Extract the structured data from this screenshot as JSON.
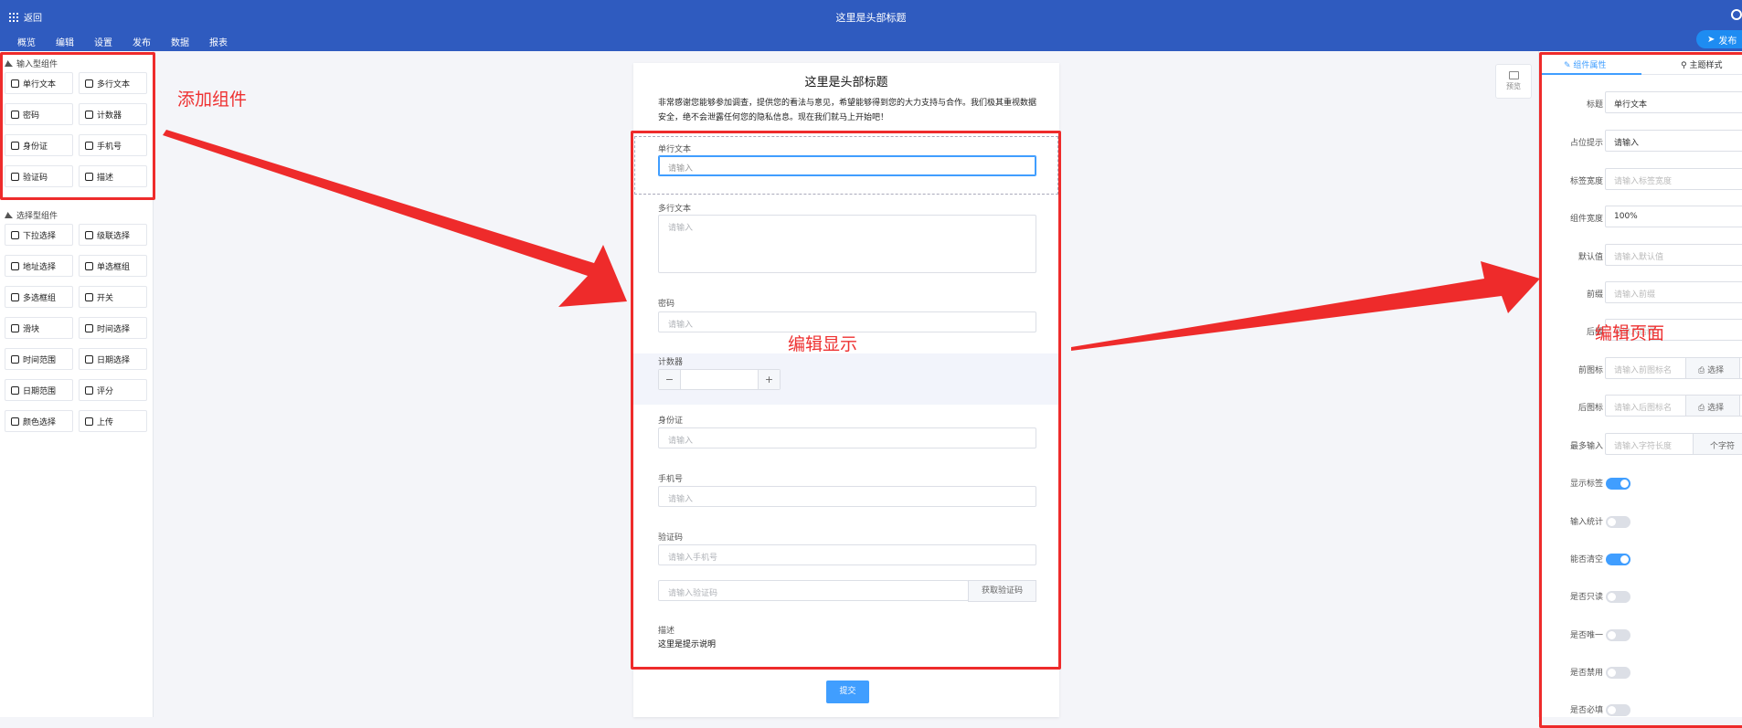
{
  "header": {
    "back_label": "返回",
    "title": "这里是头部标题",
    "nav": [
      "概览",
      "编辑",
      "设置",
      "发布",
      "数据",
      "报表"
    ],
    "publish_label": "发布"
  },
  "left_panel": {
    "input_section_title": "输入型组件",
    "input_components": [
      "单行文本",
      "多行文本",
      "密码",
      "计数器",
      "身份证",
      "手机号",
      "验证码",
      "描述"
    ],
    "select_section_title": "选择型组件",
    "select_components": [
      "下拉选择",
      "级联选择",
      "地址选择",
      "单选框组",
      "多选框组",
      "开关",
      "滑块",
      "时间选择",
      "时间范围",
      "日期选择",
      "日期范围",
      "评分",
      "颜色选择",
      "上传"
    ]
  },
  "annotations": {
    "add": "添加组件",
    "display": "编辑显示",
    "page": "编辑页面"
  },
  "form": {
    "title": "这里是头部标题",
    "description": "非常感谢您能够参加调查，提供您的看法与意见，希望能够得到您的大力支持与合作。我们极其重视数据安全，绝不会泄露任何您的隐私信息。现在我们就马上开始吧！",
    "single_label": "单行文本",
    "single_placeholder": "请输入",
    "multi_label": "多行文本",
    "multi_placeholder": "请输入",
    "password_label": "密码",
    "password_placeholder": "请输入",
    "counter_label": "计数器",
    "counter_minus": "−",
    "counter_plus": "+",
    "id_label": "身份证",
    "id_placeholder": "请输入",
    "phone_label": "手机号",
    "phone_placeholder": "请输入",
    "verify_label": "验证码",
    "verify_phone_placeholder": "请输入手机号",
    "verify_code_placeholder": "请输入验证码",
    "verify_button": "获取验证码",
    "desc_label": "描述",
    "desc_text": "这里是提示说明",
    "submit_label": "提交"
  },
  "preview_label": "预览",
  "right_panel": {
    "tab_props": "组件属性",
    "tab_theme": "主题样式",
    "fields": [
      {
        "label": "标题",
        "value": "单行文本"
      },
      {
        "label": "占位提示",
        "value": "请输入"
      },
      {
        "label": "标签宽度",
        "placeholder": "请输入标签宽度"
      },
      {
        "label": "组件宽度",
        "value": "100%"
      },
      {
        "label": "默认值",
        "placeholder": "请输入默认值"
      },
      {
        "label": "前缀",
        "placeholder": "请输入前缀"
      },
      {
        "label": "后缀",
        "placeholder": "请输入后缀"
      }
    ],
    "front_icon_label": "前图标",
    "front_icon_placeholder": "请输入前图标名",
    "back_icon_label": "后图标",
    "back_icon_placeholder": "请输入后图标名",
    "choose_label": "选择",
    "max_label": "最多输入",
    "max_placeholder": "请输入字符长度",
    "max_unit": "个字符",
    "toggles": [
      {
        "label": "显示标签",
        "on": true
      },
      {
        "label": "输入统计",
        "on": false
      },
      {
        "label": "能否清空",
        "on": true
      },
      {
        "label": "是否只读",
        "on": false
      },
      {
        "label": "是否唯一",
        "on": false
      },
      {
        "label": "是否禁用",
        "on": false
      },
      {
        "label": "是否必填",
        "on": false
      }
    ]
  },
  "colors": {
    "header": "#2f5bbf",
    "accent": "#409eff",
    "annotation": "#ee2b2b"
  }
}
